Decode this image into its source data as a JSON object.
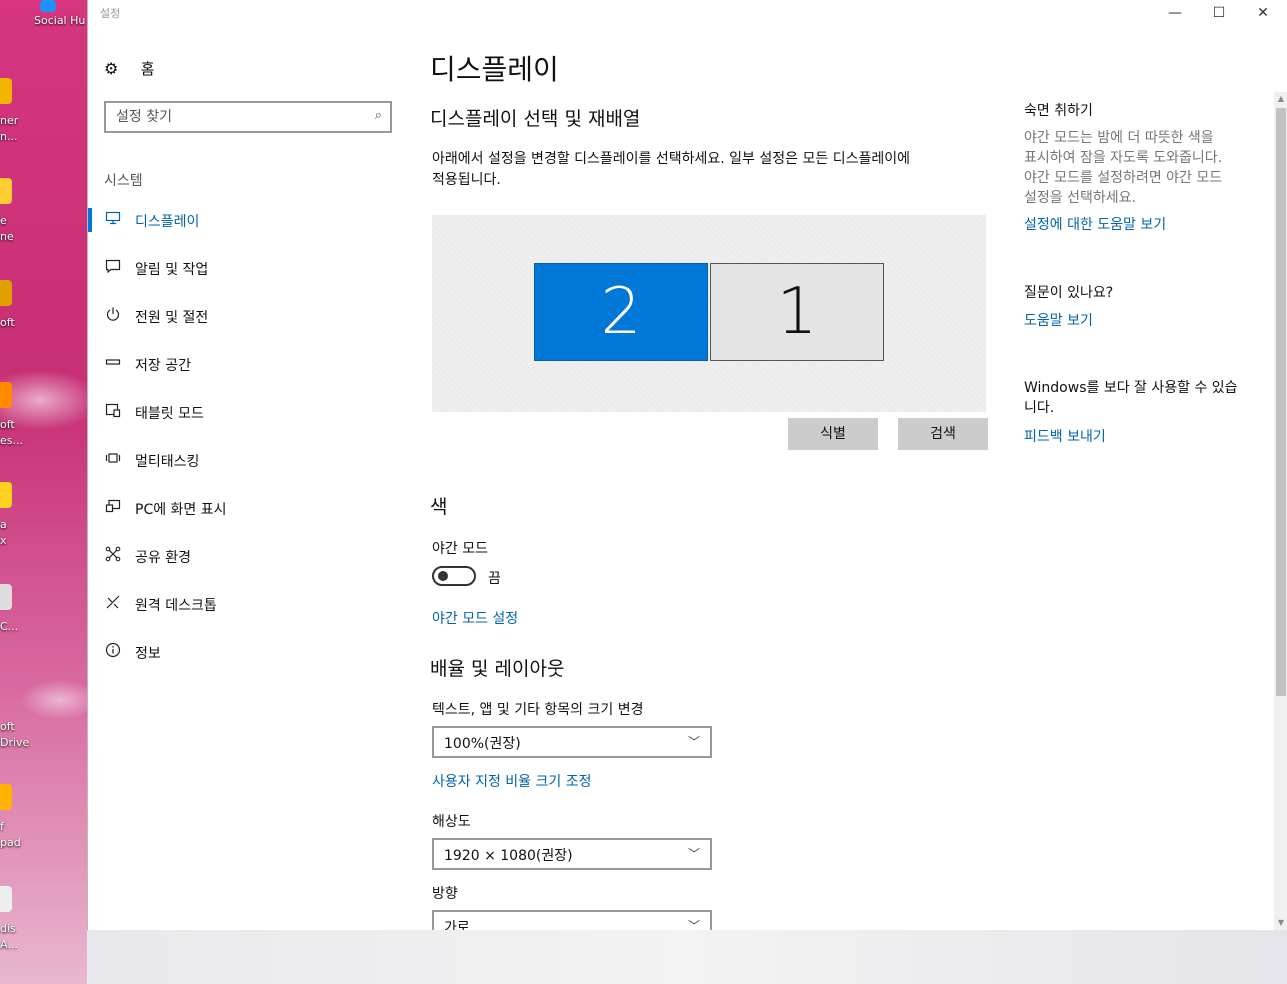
{
  "window": {
    "title": "설정",
    "controls": {
      "minimize": "—",
      "maximize": "☐",
      "close": "✕"
    }
  },
  "desktop": {
    "icons": [
      {
        "label": "Social Hu",
        "color": "#1e90ff"
      },
      {
        "label": "ner",
        "color": "#f2b400"
      },
      {
        "label": "n...",
        "color": "#f2b400"
      },
      {
        "label": "e",
        "color": "#ffcc33"
      },
      {
        "label": "ne",
        "color": "#ffcc33"
      },
      {
        "label": "oft",
        "color": "#e0a000"
      },
      {
        "label": "oft",
        "color": "#ff8a00"
      },
      {
        "label": "es...",
        "color": "#ff8a00"
      },
      {
        "label": "a",
        "color": "#ffd21f"
      },
      {
        "label": "x",
        "color": "#ffd21f"
      },
      {
        "label": "C...",
        "color": "#dddddd"
      },
      {
        "label": "oft",
        "color": "#ffffff"
      },
      {
        "label": "Drive",
        "color": "#ffffff"
      },
      {
        "label": "f",
        "color": "#ffb300"
      },
      {
        "label": "pad",
        "color": "#ffb300"
      },
      {
        "label": "dis",
        "color": "#eeeeee"
      },
      {
        "label": "A...",
        "color": "#eeeeee"
      }
    ]
  },
  "sidebar": {
    "home_label": "홈",
    "search_placeholder": "설정 찾기",
    "section_label": "시스템",
    "items": [
      {
        "label": "디스플레이",
        "icon": "monitor-icon",
        "active": true
      },
      {
        "label": "알림 및 작업",
        "icon": "notification-icon"
      },
      {
        "label": "전원 및 절전",
        "icon": "power-icon"
      },
      {
        "label": "저장 공간",
        "icon": "storage-icon"
      },
      {
        "label": "태블릿 모드",
        "icon": "tablet-icon"
      },
      {
        "label": "멀티태스킹",
        "icon": "multitasking-icon"
      },
      {
        "label": "PC에 화면 표시",
        "icon": "project-icon"
      },
      {
        "label": "공유 환경",
        "icon": "share-icon"
      },
      {
        "label": "원격 데스크톱",
        "icon": "remote-desktop-icon"
      },
      {
        "label": "정보",
        "icon": "info-icon"
      }
    ]
  },
  "main": {
    "title": "디스플레이",
    "arrange_heading": "디스플레이 선택 및 재배열",
    "arrange_desc_line1": "아래에서 설정을 변경할 디스플레이를 선택하세요. 일부 설정은 모든 디스플레이에",
    "arrange_desc_line2": "적용됩니다.",
    "monitors": {
      "primary_selected": "2",
      "secondary": "1"
    },
    "identify_button": "식별",
    "detect_button": "검색",
    "color_heading": "색",
    "night_mode_label": "야간 모드",
    "night_mode_state": "끔",
    "night_mode_on": false,
    "night_mode_settings_link": "야간 모드 설정",
    "scale_heading": "배율 및 레이아웃",
    "scale_label": "텍스트, 앱 및 기타 항목의 크기 변경",
    "scale_value": "100%(권장)",
    "custom_scale_link": "사용자 지정 비율 크기 조정",
    "resolution_label": "해상도",
    "resolution_value": "1920 × 1080(권장)",
    "orientation_label": "방향",
    "orientation_value": "가로"
  },
  "right": {
    "sleep_heading": "숙면 취하기",
    "sleep_text_1": "야간 모드는 밤에 더 따뜻한 색을",
    "sleep_text_2": "표시하여 잠을 자도록 도와줍니다.",
    "sleep_text_3": "야간 모드를 설정하려면 야간 모드",
    "sleep_text_4": "설정을 선택하세요.",
    "help_link": "설정에 대한 도움말 보기",
    "question_heading": "질문이 있나요?",
    "get_help_link": "도움말 보기",
    "feedback_text_1": "Windows를 보다 잘 사용할 수 있습",
    "feedback_text_2": "니다.",
    "feedback_link": "피드백 보내기"
  },
  "colors": {
    "accent": "#0078d7",
    "link": "#0063b1",
    "button_bg": "#cccccc"
  }
}
